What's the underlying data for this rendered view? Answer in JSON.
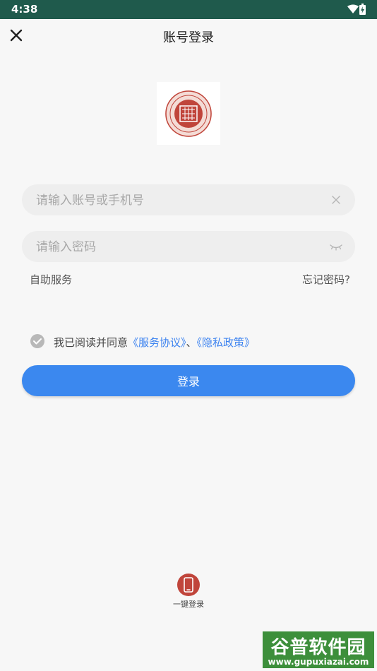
{
  "status_bar": {
    "time": "4:38",
    "wifi_icon": "wifi-icon",
    "battery_icon": "battery-charging-icon"
  },
  "header": {
    "title": "账号登录",
    "close_icon": "close-icon"
  },
  "logo": {
    "icon": "seal-logo-icon",
    "color": "#c0453b"
  },
  "account_field": {
    "placeholder": "请输入账号或手机号",
    "value": "",
    "clear_icon": "clear-icon"
  },
  "password_field": {
    "placeholder": "请输入密码",
    "value": "",
    "visibility_icon": "eye-closed-icon"
  },
  "links": {
    "self_service": "自助服务",
    "forgot_password": "忘记密码?"
  },
  "agreement": {
    "prefix": "我已阅读并同意",
    "service_agreement": "《服务协议》",
    "separator": "、",
    "privacy_policy": "《隐私政策》",
    "check_icon": "check-circle-icon"
  },
  "login_button": {
    "label": "登录",
    "color": "#3b88ef"
  },
  "one_key_login": {
    "label": "一键登录",
    "icon": "phone-icon",
    "color": "#c0453b"
  },
  "watermark": {
    "name": "谷普软件园",
    "url": "www.gupuxiazai.com"
  }
}
